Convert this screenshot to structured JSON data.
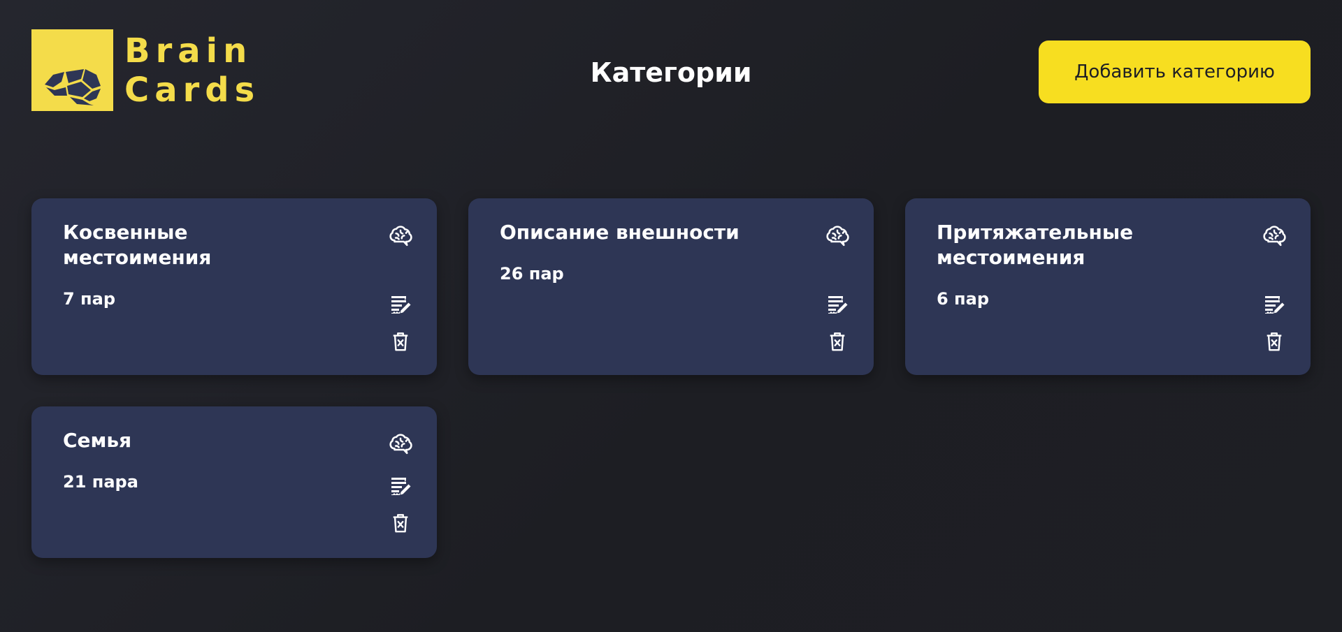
{
  "header": {
    "logo_line1": "Brain",
    "logo_line2": "Cards",
    "logo_icon": "brain-logo-icon",
    "title": "Категории",
    "add_button_label": "Добавить категорию"
  },
  "colors": {
    "background": "#1f2025",
    "accent_yellow": "#f7de20",
    "logo_yellow": "#f4dc4a",
    "card_background": "#2e3655",
    "text": "#ffffff"
  },
  "cards": [
    {
      "title": "Косвенные местоимения",
      "count": "7 пар"
    },
    {
      "title": "Описание внешности",
      "count": "26 пар"
    },
    {
      "title": "Притяжательные местоимения",
      "count": "6 пар"
    },
    {
      "title": "Семья",
      "count": "21 пара"
    }
  ],
  "card_icons": [
    "brain-icon",
    "edit-icon",
    "delete-icon"
  ]
}
